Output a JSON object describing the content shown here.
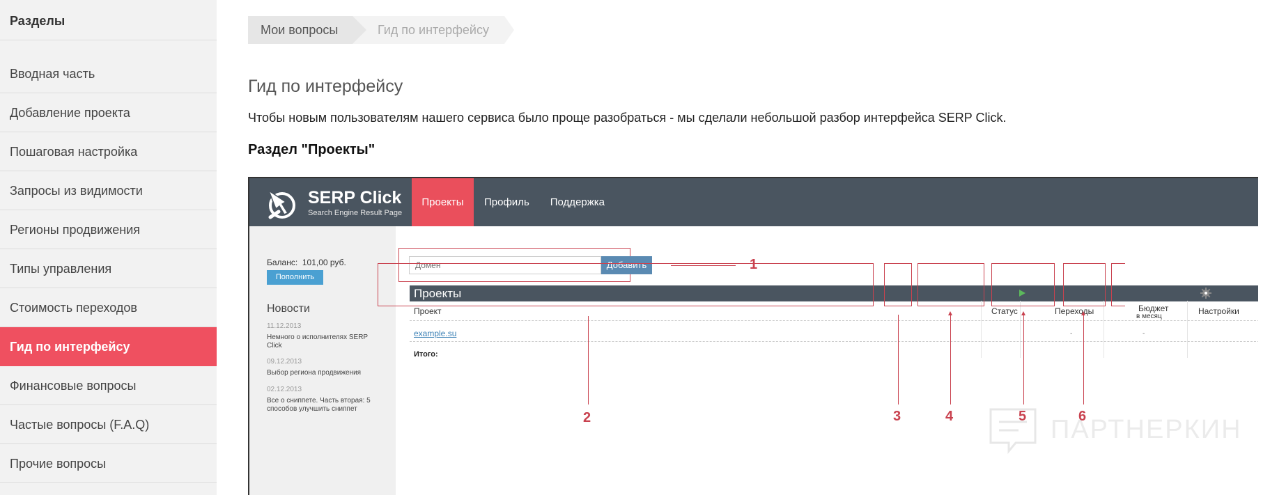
{
  "sidebar": {
    "title": "Разделы",
    "items": [
      {
        "label": "Вводная часть"
      },
      {
        "label": "Добавление проекта"
      },
      {
        "label": "Пошаговая настройка"
      },
      {
        "label": "Запросы из видимости"
      },
      {
        "label": "Регионы продвижения"
      },
      {
        "label": "Типы управления"
      },
      {
        "label": "Стоимость переходов"
      },
      {
        "label": "Гид по интерфейсу",
        "active": true
      },
      {
        "label": "Финансовые вопросы"
      },
      {
        "label": "Частые вопросы (F.A.Q)"
      },
      {
        "label": "Прочие вопросы"
      }
    ]
  },
  "breadcrumb": [
    "Мои вопросы",
    "Гид по интерфейсу"
  ],
  "page": {
    "title": "Гид по интерфейсу",
    "intro": "Чтобы новым пользователям нашего сервиса было проще разобраться - мы сделали небольшой разбор интерфейса SERP Click.",
    "section_title": "Раздел \"Проекты\""
  },
  "screenshot": {
    "logo_title": "SERP Click",
    "logo_subtitle": "Search Engine Result Page",
    "nav": [
      "Проекты",
      "Профиль",
      "Поддержка"
    ],
    "balance_label": "Баланс:",
    "balance_value": "101,00 руб.",
    "topup_label": "Пополнить",
    "news_title": "Новости",
    "news": [
      {
        "date": "11.12.2013",
        "text": "Немного о исполнителях SERP Click"
      },
      {
        "date": "09.12.2013",
        "text": "Выбор региона продвижения"
      },
      {
        "date": "02.12.2013",
        "text": "Все о сниппете. Часть вторая: 5 способов улучшить сниппет"
      }
    ],
    "domain_placeholder": "Домен",
    "add_label": "Добавить",
    "projects_header": "Проекты",
    "columns": {
      "project": "Проект",
      "status": "Статус",
      "transitions": "Переходы",
      "budget": "Бюджет",
      "budget_sub": "в месяц",
      "settings": "Настройки"
    },
    "row": {
      "project": "example.su",
      "transitions": "-",
      "budget": "-"
    },
    "total_label": "Итого:",
    "callouts": [
      "1",
      "2",
      "3",
      "4",
      "5",
      "6"
    ],
    "watermark": "ПАРТНЕРКИН"
  },
  "colors": {
    "accent": "#ef5060",
    "callout": "#c9424f",
    "app_header": "#4a5560"
  }
}
